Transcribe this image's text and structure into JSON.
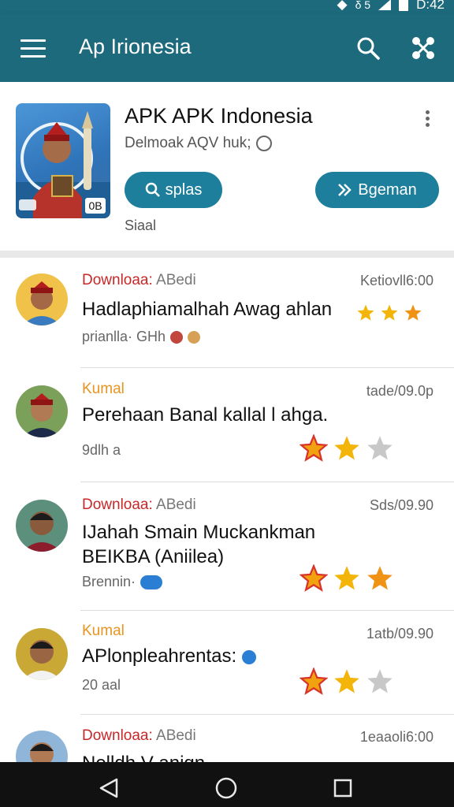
{
  "status_bar": {
    "time": "D:42",
    "vibrate_icon": "vibrate-icon",
    "sim_indicator": "δ 5"
  },
  "app_bar": {
    "title": "Ap Irionesia",
    "menu_icon": "menu-icon",
    "search_icon": "search-icon",
    "share_icon": "share-icon"
  },
  "header": {
    "app_name": "APK APK Indonesia",
    "subtitle": "Delmoak AQV huk;",
    "image_badge": "0B",
    "buttons": {
      "primary": "splas",
      "secondary": "Bgeman"
    },
    "label": "Siaal"
  },
  "feed": [
    {
      "tag": "Downloaa:",
      "source": "ABedi",
      "tag_color": "#c62828",
      "time": "Ketiovll6:00",
      "title_lines": [
        "Hadlaphiamalhah Awag ahlan"
      ],
      "meta": "prianlla·  GHh",
      "rating": 3,
      "star_style": "small-gold"
    },
    {
      "tag": "Kumal",
      "source": "",
      "tag_color": "#e69522",
      "time": "tade/09.0p",
      "title_lines": [
        "Perehaan Banal kallal l ahga."
      ],
      "meta": "9dlh   a",
      "rating": 2,
      "star_style": "large"
    },
    {
      "tag": "Downloaa:",
      "source": "ABedi",
      "tag_color": "#c62828",
      "time": "Sds/09.90",
      "title_lines": [
        "IJahah Smain Muckankman",
        "BEIKBA (Aniilea)"
      ],
      "meta": "Brennin·",
      "rating": 3,
      "star_style": "large"
    },
    {
      "tag": "Kumal",
      "source": "",
      "tag_color": "#e69522",
      "time": "1atb/09.90",
      "title_lines": [
        "APlonpleahrentas:"
      ],
      "meta": "20   aal",
      "rating": 2,
      "star_style": "large"
    },
    {
      "tag": "Downloaa:",
      "source": "ABedi",
      "tag_color": "#c62828",
      "time": "1eaaoli6:00",
      "title_lines": [
        "Nelldh V anign"
      ],
      "meta": "",
      "rating": 0,
      "star_style": "none"
    }
  ],
  "colors": {
    "primary": "#1c6a7c",
    "button": "#1d7f9c",
    "download_red": "#c62828",
    "kumal_orange": "#e69522"
  }
}
